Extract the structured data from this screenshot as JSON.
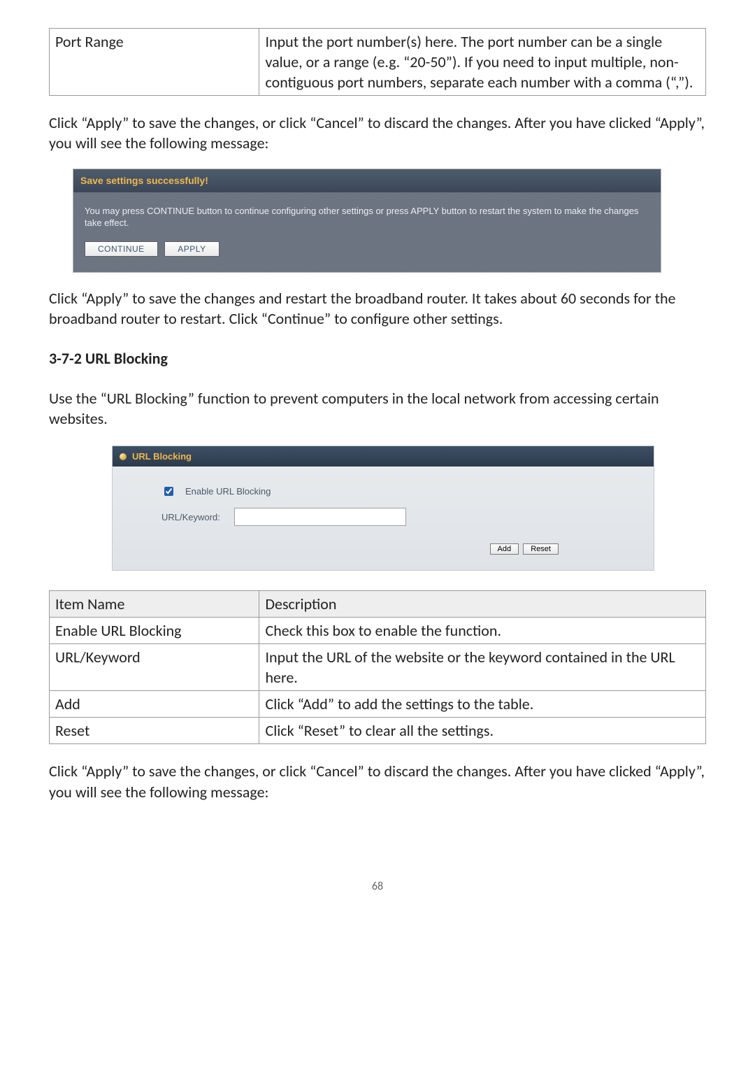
{
  "top_table": {
    "rows": [
      {
        "item": "Port Range",
        "desc": "Input the port number(s) here. The port number can be a single value, or a range (e.g. “20-50”). If you need to input multiple, non-contiguous port numbers, separate each number with a comma (“,”)."
      }
    ]
  },
  "para1": "Click “Apply” to save the changes, or click “Cancel” to discard the changes. After you have clicked “Apply”, you will see the following message:",
  "msgbox": {
    "title": "Save settings successfully!",
    "body": "You may press CONTINUE button to continue configuring other settings or press APPLY button to restart the system to make the changes take effect.",
    "continue_label": "CONTINUE",
    "apply_label": "APPLY"
  },
  "para2": "Click “Apply” to save the changes and restart the broadband router. It takes about 60 seconds for the broadband router to restart. Click “Continue” to configure other settings.",
  "heading": "3-7-2 URL Blocking",
  "para3": "Use the “URL Blocking” function to prevent computers in the local network from accessing certain websites.",
  "urlpanel": {
    "title": "URL Blocking",
    "enable_label": "Enable URL Blocking",
    "keyword_label": "URL/Keyword:",
    "add_label": "Add",
    "reset_label": "Reset"
  },
  "bottom_table": {
    "header": {
      "c1": "Item Name",
      "c2": "Description"
    },
    "rows": [
      {
        "item": "Enable URL Blocking",
        "desc": "Check this box to enable the function."
      },
      {
        "item": "URL/Keyword",
        "desc": "Input the URL of the website or the keyword contained in the URL here."
      },
      {
        "item": "Add",
        "desc": "Click “Add” to add the settings to the table."
      },
      {
        "item": "Reset",
        "desc": "Click “Reset” to clear all the settings."
      }
    ]
  },
  "para4": "Click “Apply” to save the changes, or click “Cancel” to discard the changes. After you have clicked “Apply”, you will see the following message:",
  "page_number": "68"
}
